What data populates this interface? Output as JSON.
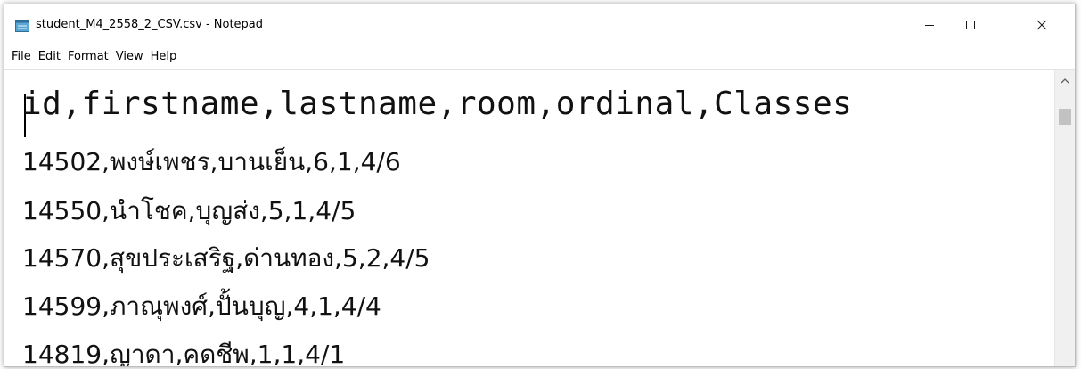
{
  "window": {
    "title": "student_M4_2558_2_CSV.csv - Notepad",
    "icon": "notepad-icon",
    "controls": {
      "minimize": "minimize-icon",
      "maximize": "maximize-icon",
      "close": "close-icon"
    }
  },
  "menu": {
    "items": [
      "File",
      "Edit",
      "Format",
      "View",
      "Help"
    ]
  },
  "document": {
    "lines": [
      "id,firstname,lastname,room,ordinal,Classes",
      "14502,พงษ์เพชร,บานเย็น,6,1,4/6",
      "14550,นำโชค,บุญส่ง,5,1,4/5",
      "14570,สุขประเสริฐ,ด่านทอง,5,2,4/5",
      "14599,ภาณุพงศ์,ปั้นบุญ,4,1,4/4",
      "14819,ญาดา,คดชีพ,1,1,4/1"
    ]
  },
  "colors": {
    "text": "#111111",
    "window_border": "#bdbdbd",
    "scroll_track": "#f0f0f0",
    "scroll_thumb": "#c2c2c2"
  }
}
